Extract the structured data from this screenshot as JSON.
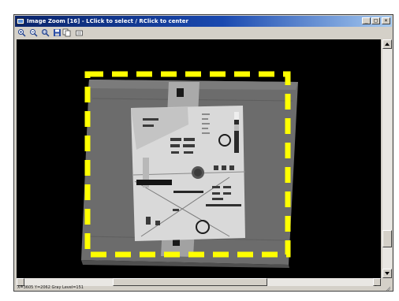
{
  "window": {
    "title": "Image Zoom [16] - LClick to select / RClick to center"
  },
  "titlebar_buttons": {
    "minimize": "_",
    "maximize": "□",
    "close": "×"
  },
  "toolbar": {
    "tools": [
      "zoom-in-icon",
      "zoom-out-icon",
      "zoom-fit-icon",
      "save-icon",
      "copy-icon",
      "options-icon"
    ]
  },
  "viewport": {
    "background": "#000000",
    "selection_color": "#ffff00",
    "selection_style": "dashed"
  },
  "status": {
    "text": "X=3605 Y=2062 Gray Level=151"
  },
  "scrollbars": {
    "vertical_position": 0.8,
    "horizontal_position": 0.4
  }
}
